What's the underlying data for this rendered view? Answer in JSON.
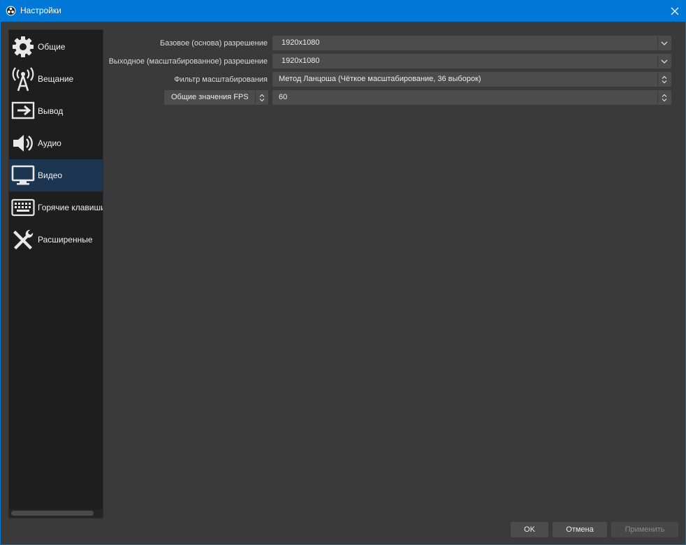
{
  "window": {
    "title": "Настройки"
  },
  "sidebar": {
    "items": [
      {
        "label": "Общие",
        "icon": "gear-icon"
      },
      {
        "label": "Вещание",
        "icon": "broadcast-tower-icon"
      },
      {
        "label": "Вывод",
        "icon": "output-icon"
      },
      {
        "label": "Аудио",
        "icon": "speaker-icon"
      },
      {
        "label": "Видео",
        "icon": "monitor-icon",
        "active": true
      },
      {
        "label": "Горячие клавиши",
        "icon": "keyboard-icon"
      },
      {
        "label": "Расширенные",
        "icon": "tools-icon"
      }
    ]
  },
  "video": {
    "base_resolution": {
      "label": "Базовое (основа) разрешение",
      "value": "1920x1080"
    },
    "output_resolution": {
      "label": "Выходное (масштабированное) разрешение",
      "value": "1920x1080"
    },
    "downscale_filter": {
      "label": "Фильтр масштабирования",
      "value": "Метод Ланцоша (Чёткое масштабирование, 36 выборок)"
    },
    "fps": {
      "mode_label": "Общие значения FPS",
      "value": "60"
    }
  },
  "buttons": {
    "ok": "OK",
    "cancel": "Отмена",
    "apply": "Применить"
  },
  "colors": {
    "titlebar": "#0078d7",
    "active_item": "#1c3550",
    "background": "#3a3a3a"
  }
}
